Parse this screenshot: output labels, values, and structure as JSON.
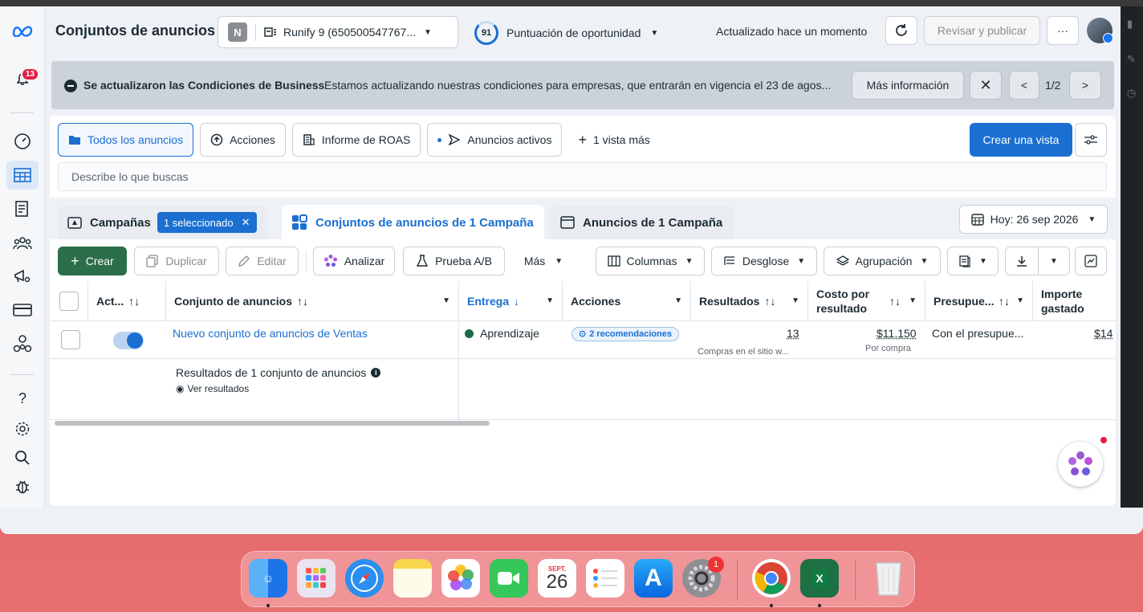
{
  "header": {
    "title": "Conjuntos de anuncios",
    "account_initial": "N",
    "account_name": "Runify 9 (650500547767...",
    "score": "91",
    "score_label": "Puntuación de oportunidad",
    "updated": "Actualizado hace un momento",
    "publish": "Revisar y publicar",
    "more": "···"
  },
  "notifications_count": "13",
  "notice": {
    "title": "Se actualizaron las Condiciones de Business",
    "text": "Estamos actualizando nuestras condiciones para empresas, que entrarán en vigencia el 23 de agos...",
    "more": "Más información",
    "page": "1/2"
  },
  "views": {
    "all": "Todos los anuncios",
    "actions": "Acciones",
    "roas": "Informe de ROAS",
    "active": "Anuncios activos",
    "more": "1 vista más",
    "create": "Crear una vista"
  },
  "search": {
    "placeholder": "Describe lo que buscas"
  },
  "level_tabs": {
    "campaigns": "Campañas",
    "selected": "1 seleccionado",
    "adsets": "Conjuntos de anuncios de 1 Campaña",
    "ads": "Anuncios de 1 Campaña",
    "date": "Hoy: 26 sep 2026"
  },
  "toolbar": {
    "create": "Crear",
    "duplicate": "Duplicar",
    "edit": "Editar",
    "analyze": "Analizar",
    "ab": "Prueba A/B",
    "more": "Más",
    "columns": "Columnas",
    "breakdown": "Desglose",
    "grouping": "Agrupación"
  },
  "table": {
    "headers": {
      "active": "Act...",
      "adset": "Conjunto de anuncios",
      "delivery": "Entrega",
      "actions": "Acciones",
      "results": "Resultados",
      "cost": "Costo por resultado",
      "budget": "Presupue...",
      "spent": "Importe gastado"
    },
    "row": {
      "name": "Nuevo conjunto de anuncios de Ventas",
      "delivery": "Aprendizaje",
      "recs": "2 recomendaciones",
      "results": "13",
      "results_sub": "Compras en el sitio w...",
      "cost": "$11.150",
      "cost_sub": "Por compra",
      "budget": "Con el presupue...",
      "spent": "$14"
    },
    "summary": {
      "title": "Resultados de 1 conjunto de anuncios",
      "link": "Ver resultados"
    }
  },
  "dock": {
    "calendar_month": "SEPT.",
    "calendar_day": "26",
    "settings_badge": "1"
  }
}
